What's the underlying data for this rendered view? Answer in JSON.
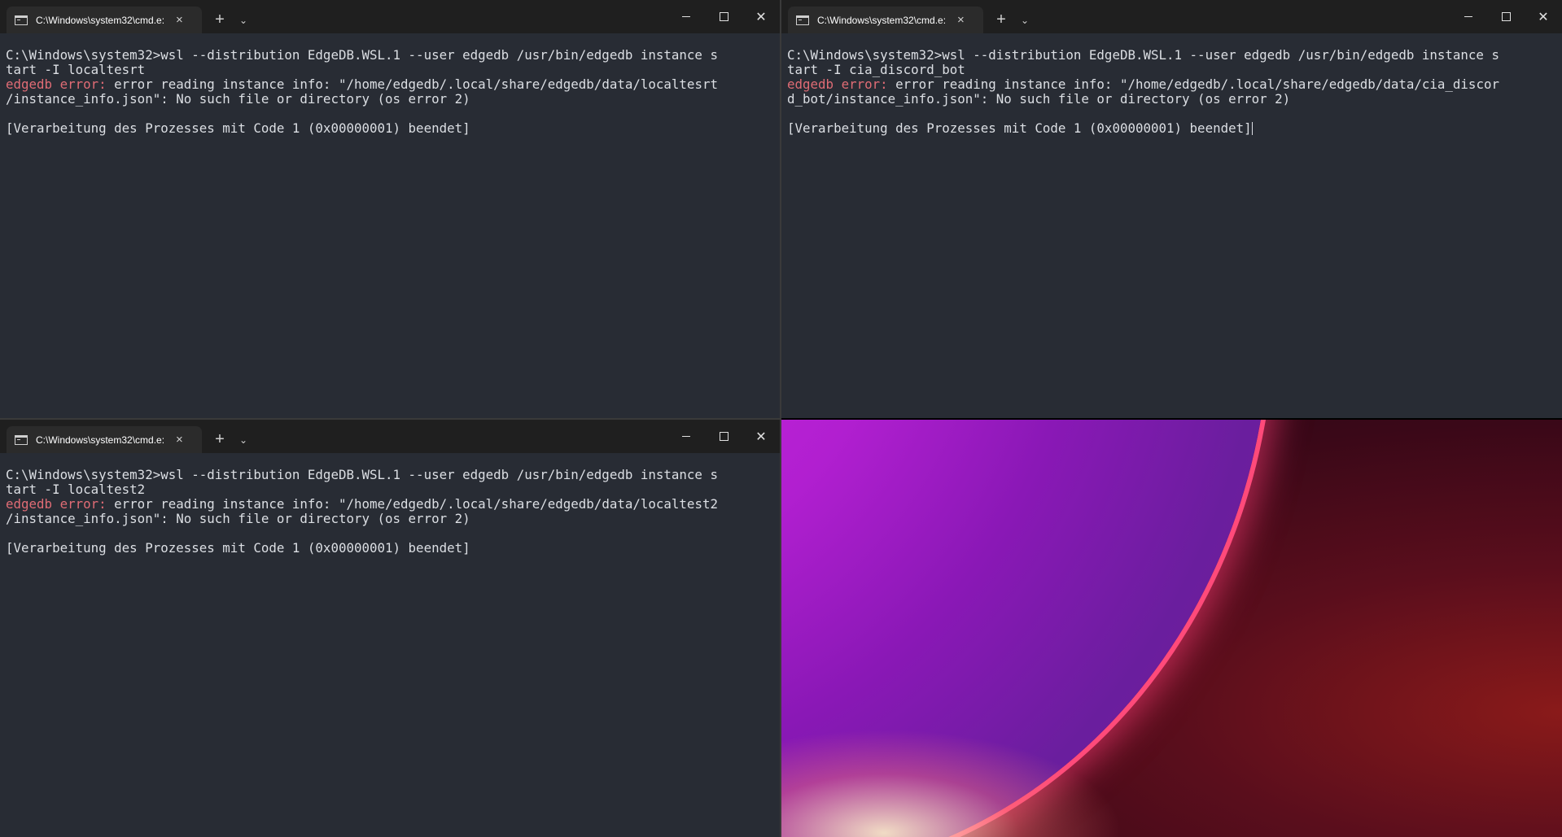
{
  "windows": [
    {
      "tab_title": "C:\\Windows\\system32\\cmd.e:",
      "lines": {
        "cmd1": "C:\\Windows\\system32>wsl --distribution EdgeDB.WSL.1 --user edgedb /usr/bin/edgedb instance s",
        "cmd2": "tart -I localtesrt",
        "err_prefix": "edgedb error:",
        "err1": " error reading instance info: \"/home/edgedb/.local/share/edgedb/data/localtesrt",
        "err2": "/instance_info.json\": No such file or directory (os error 2)",
        "status": "[Verarbeitung des Prozesses mit Code 1 (0x00000001) beendet]"
      }
    },
    {
      "tab_title": "C:\\Windows\\system32\\cmd.e:",
      "lines": {
        "cmd1": "C:\\Windows\\system32>wsl --distribution EdgeDB.WSL.1 --user edgedb /usr/bin/edgedb instance s",
        "cmd2": "tart -I cia_discord_bot",
        "err_prefix": "edgedb error:",
        "err1": " error reading instance info: \"/home/edgedb/.local/share/edgedb/data/cia_discor",
        "err2": "d_bot/instance_info.json\": No such file or directory (os error 2)",
        "status": "[Verarbeitung des Prozesses mit Code 1 (0x00000001) beendet]"
      }
    },
    {
      "tab_title": "C:\\Windows\\system32\\cmd.e:",
      "lines": {
        "cmd1": "C:\\Windows\\system32>wsl --distribution EdgeDB.WSL.1 --user edgedb /usr/bin/edgedb instance s",
        "cmd2": "tart -I localtest2",
        "err_prefix": "edgedb error:",
        "err1": " error reading instance info: \"/home/edgedb/.local/share/edgedb/data/localtest2",
        "err2": "/instance_info.json\": No such file or directory (os error 2)",
        "status": "[Verarbeitung des Prozesses mit Code 1 (0x00000001) beendet]"
      }
    }
  ],
  "icons": {
    "tab_close": "×",
    "new_tab": "+",
    "dropdown": "⌄",
    "close": "✕"
  },
  "colors": {
    "terminal_bg": "#282c34",
    "terminal_fg": "#dcdfe4",
    "error_red": "#e06c75",
    "titlebar_bg": "#1f1f1f"
  }
}
